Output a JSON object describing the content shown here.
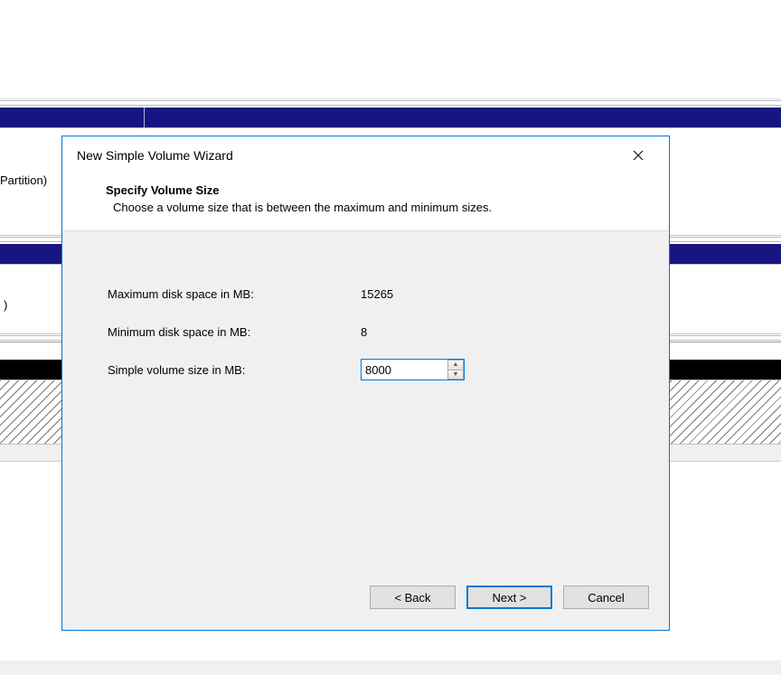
{
  "bg": {
    "partition_label": "Partition)",
    "another_label": ")"
  },
  "dialog": {
    "title": "New Simple Volume Wizard",
    "header_title": "Specify Volume Size",
    "header_sub": "Choose a volume size that is between the maximum and minimum sizes.",
    "max_label": "Maximum disk space in MB:",
    "max_value": "15265",
    "min_label": "Minimum disk space in MB:",
    "min_value": "8",
    "size_label": "Simple volume size in MB:",
    "size_value": "8000",
    "back": "< Back",
    "next": "Next >",
    "cancel": "Cancel"
  }
}
